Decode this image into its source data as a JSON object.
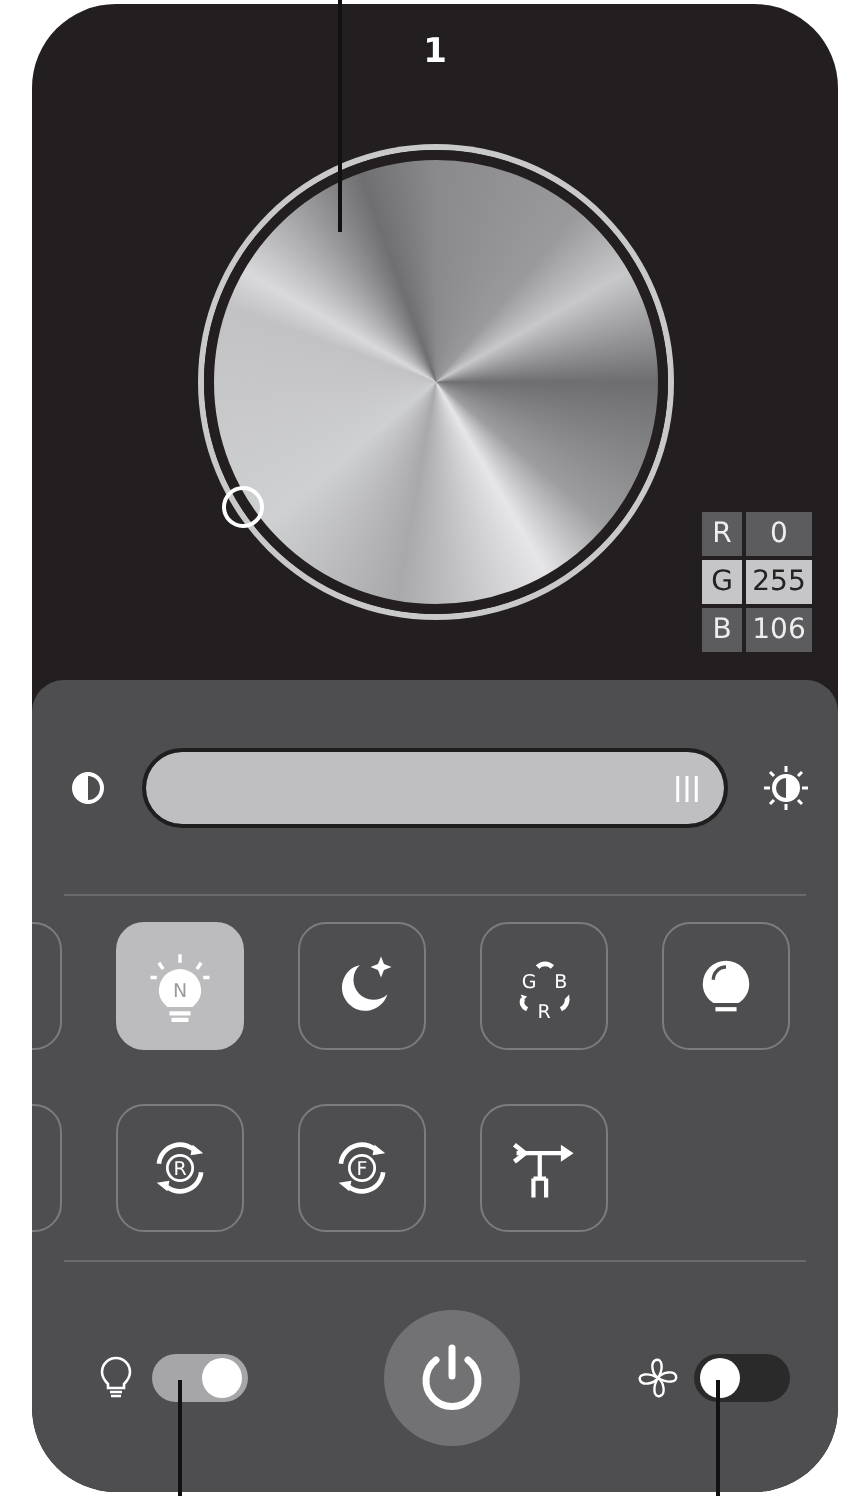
{
  "header": {
    "number": "1"
  },
  "color_readout": [
    {
      "label": "R",
      "value": "0",
      "selected": false
    },
    {
      "label": "G",
      "value": "255",
      "selected": true
    },
    {
      "label": "B",
      "value": "106",
      "selected": false
    }
  ],
  "brightness": {
    "level": 1
  },
  "mode_rows": [
    [
      {
        "kind": "blank",
        "selected": false
      },
      {
        "kind": "bulb-letter",
        "letters": [
          "N"
        ],
        "selected": true
      },
      {
        "kind": "moon",
        "selected": false
      },
      {
        "kind": "cycle3",
        "letters": [
          "G",
          "B",
          "R"
        ],
        "selected": false
      },
      {
        "kind": "bulb",
        "selected": false
      }
    ],
    [
      {
        "kind": "blank",
        "selected": false
      },
      {
        "kind": "cycle",
        "letters": [
          "R"
        ],
        "selected": false
      },
      {
        "kind": "cycle",
        "letters": [
          "F"
        ],
        "selected": false
      },
      {
        "kind": "vane",
        "selected": false
      }
    ]
  ],
  "light_toggle": {
    "on": true
  },
  "fan_toggle": {
    "on": false
  }
}
